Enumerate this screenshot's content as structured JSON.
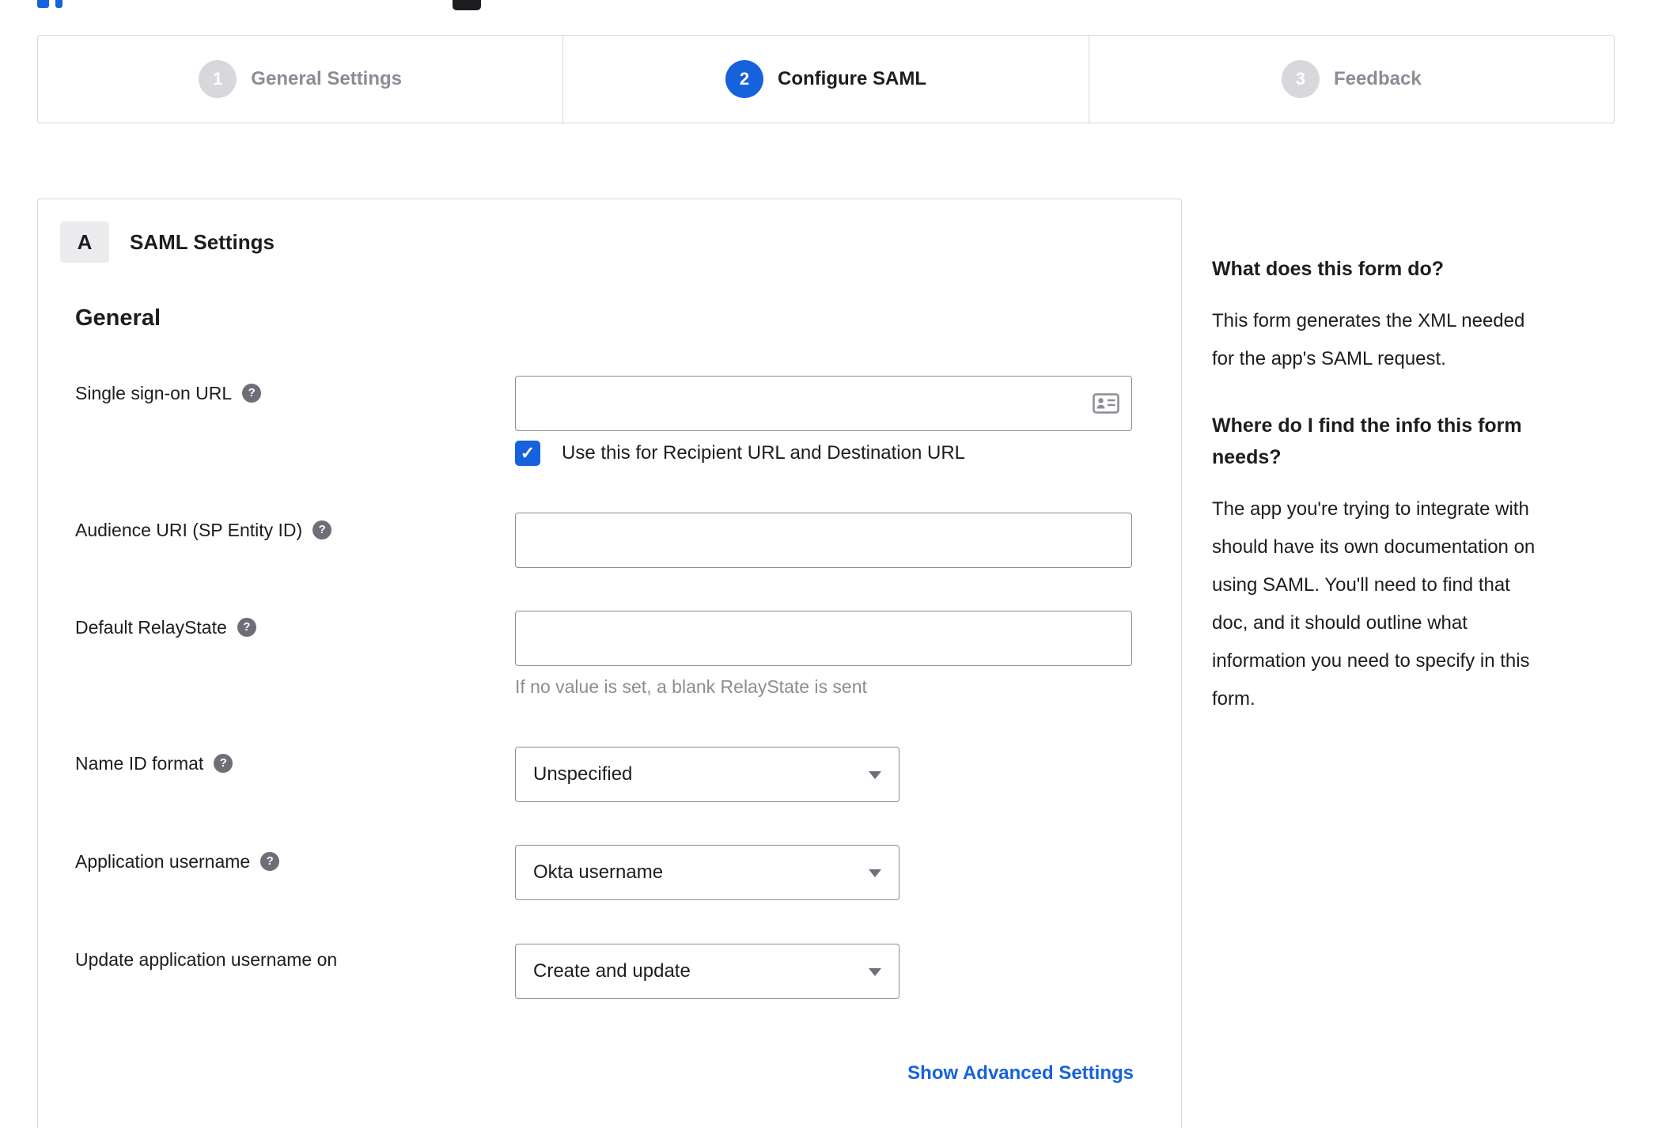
{
  "colors": {
    "accent": "#1662dd",
    "panel_border": "#d7d7dc",
    "input_border": "#8c8c96",
    "text": "#1d1d21",
    "muted_text": "#8c8c96",
    "inactive_step": "#d7d7dc"
  },
  "icons": {
    "help": "?",
    "checkmark": "✓"
  },
  "stepper": {
    "steps": [
      {
        "number": "1",
        "label": "General Settings",
        "state": "inactive"
      },
      {
        "number": "2",
        "label": "Configure SAML",
        "state": "active"
      },
      {
        "number": "3",
        "label": "Feedback",
        "state": "inactive"
      }
    ]
  },
  "panel": {
    "section_badge": "A",
    "section_title": "SAML Settings",
    "group_title": "General",
    "sso_url": {
      "label": "Single sign-on URL",
      "value": ""
    },
    "sso_checkbox": {
      "label": "Use this for Recipient URL and Destination URL",
      "checked": true
    },
    "audience_uri": {
      "label": "Audience URI (SP Entity ID)",
      "value": ""
    },
    "relay_state": {
      "label": "Default RelayState",
      "value": "",
      "hint": "If no value is set, a blank RelayState is sent"
    },
    "name_id_format": {
      "label": "Name ID format",
      "value": "Unspecified"
    },
    "app_username": {
      "label": "Application username",
      "value": "Okta username"
    },
    "update_app_username": {
      "label": "Update application username on",
      "value": "Create and update"
    },
    "advanced_link": "Show Advanced Settings"
  },
  "sidebar": {
    "q1_title": "What does this form do?",
    "q1_body": "This form generates the XML needed\nfor the app's SAML request.",
    "q2_title": "Where do I find the info this form\nneeds?",
    "q2_body": "The app you're trying to integrate with\nshould have its own documentation on\nusing SAML. You'll need to find that\ndoc, and it should outline what\ninformation you need to specify in this\nform."
  }
}
